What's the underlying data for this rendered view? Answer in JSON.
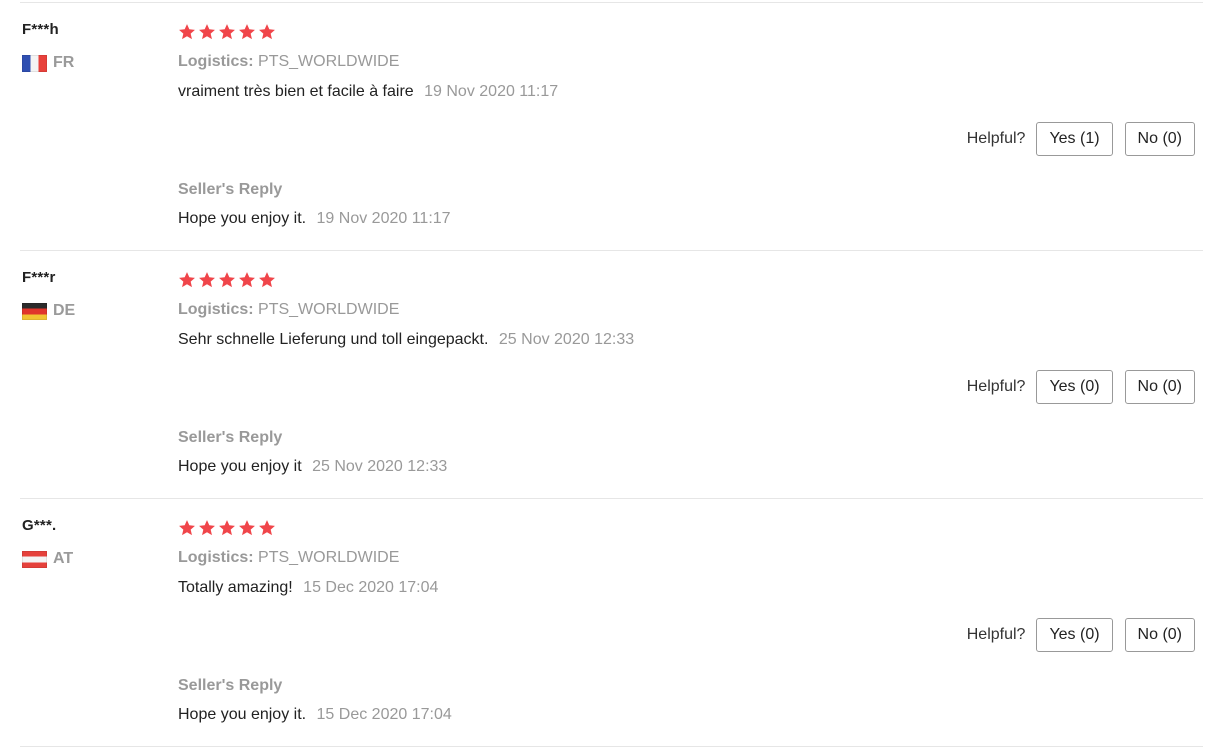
{
  "reviews": [
    {
      "user": "F***h",
      "country": "FR",
      "flag_icon": "france-flag-icon",
      "stars": 5,
      "logistics_label": "Logistics:",
      "logistics_value": "PTS_WORLDWIDE",
      "text": "vraiment très bien et facile à faire",
      "date": "19 Nov 2020 11:17",
      "helpful_label": "Helpful?",
      "yes_label": "Yes (1)",
      "no_label": "No (0)",
      "reply_title": "Seller's Reply",
      "reply_text": "Hope you enjoy it.",
      "reply_date": "19 Nov 2020 11:17"
    },
    {
      "user": "F***r",
      "country": "DE",
      "flag_icon": "germany-flag-icon",
      "stars": 5,
      "logistics_label": "Logistics:",
      "logistics_value": "PTS_WORLDWIDE",
      "text": "Sehr schnelle Lieferung und toll eingepackt.",
      "date": "25 Nov 2020 12:33",
      "helpful_label": "Helpful?",
      "yes_label": "Yes (0)",
      "no_label": "No (0)",
      "reply_title": "Seller's Reply",
      "reply_text": "Hope you enjoy it",
      "reply_date": "25 Nov 2020 12:33"
    },
    {
      "user": "G***.",
      "country": "AT",
      "flag_icon": "austria-flag-icon",
      "stars": 5,
      "logistics_label": "Logistics:",
      "logistics_value": "PTS_WORLDWIDE",
      "text": "Totally amazing!",
      "date": "15 Dec 2020 17:04",
      "helpful_label": "Helpful?",
      "yes_label": "Yes (0)",
      "no_label": "No (0)",
      "reply_title": "Seller's Reply",
      "reply_text": "Hope you enjoy it.",
      "reply_date": "15 Dec 2020 17:04"
    }
  ],
  "colors": {
    "star": "#f0454a",
    "muted_text": "#999999",
    "divider": "#e6e6e6"
  }
}
